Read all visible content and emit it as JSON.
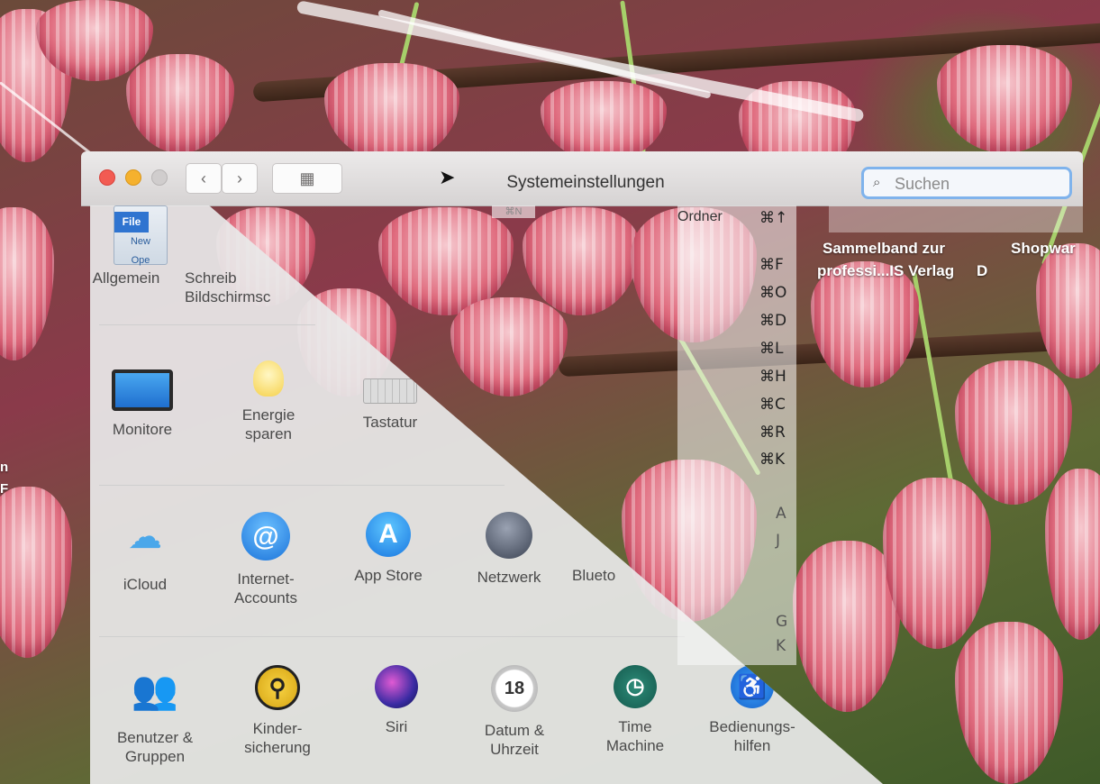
{
  "window": {
    "title": "Systemeinstellungen",
    "nav_back": "‹",
    "nav_forward": "›",
    "grid_icon": "grid-icon"
  },
  "search": {
    "placeholder": "Suchen",
    "icon": "search-icon"
  },
  "panes": {
    "row1": [
      {
        "label": "Allgemein",
        "icon": "file-icon",
        "file_header": "File",
        "file_line1": "New",
        "file_line2": "Ope"
      },
      {
        "label": "Schreib Bildschirmsc",
        "icon": "desktop-icon"
      }
    ],
    "row2": [
      {
        "label": "Monitore",
        "icon": "monitor-icon"
      },
      {
        "label": "Energie sparen",
        "icon": "bulb-icon"
      },
      {
        "label": "Tastatur",
        "icon": "keyboard-icon"
      }
    ],
    "row3": [
      {
        "label": "iCloud",
        "icon": "icloud-icon"
      },
      {
        "label": "Internet-Accounts",
        "icon": "at-icon"
      },
      {
        "label": "App Store",
        "icon": "appstore-icon"
      },
      {
        "label": "Netzwerk",
        "icon": "network-icon"
      },
      {
        "label": "Blueto",
        "icon": "bluetooth-icon"
      }
    ],
    "row4": [
      {
        "label": "Benutzer & Gruppen",
        "icon": "users-icon"
      },
      {
        "label": "Kinder-sicherung",
        "icon": "parental-controls-icon"
      },
      {
        "label": "Siri",
        "icon": "siri-icon"
      },
      {
        "label": "Datum & Uhrzeit",
        "icon": "clock-icon",
        "calendar_day": "18"
      },
      {
        "label": "Time Machine",
        "icon": "time-machine-icon"
      },
      {
        "label": "Bedienungs-hilfen",
        "icon": "accessibility-icon"
      }
    ]
  },
  "ghost_menu": {
    "item_label": "Ordner",
    "top_shortcut": "⌘N",
    "shortcuts": [
      "⌘↑",
      "⌘F",
      "⌘O",
      "⌘D",
      "⌘L",
      "⌘H",
      "⌘C",
      "⌘R",
      "⌘K"
    ],
    "fragments": [
      "A",
      "J",
      "G",
      "K"
    ]
  },
  "background_text": {
    "book1_line1": "Sammelband zur",
    "book1_line2": "professi...IS Verlag",
    "book2": "Shopwar",
    "book2_fragment": "D",
    "edge1": "n",
    "edge2": "F"
  }
}
